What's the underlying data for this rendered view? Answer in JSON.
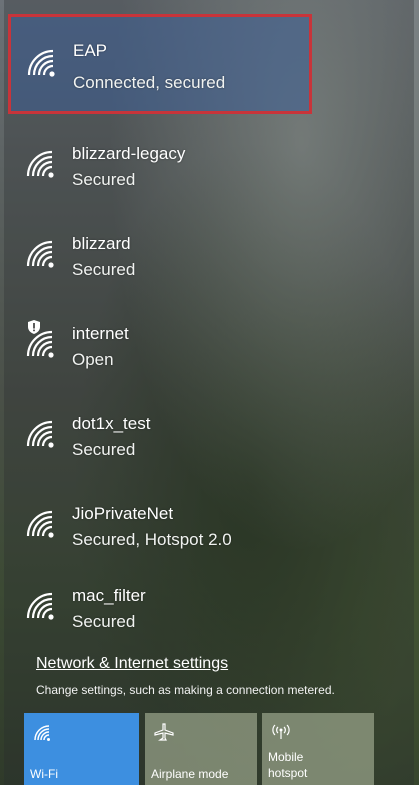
{
  "networks": [
    {
      "name": "EAP",
      "status": "Connected, secured",
      "icon": "wifi-signal-icon",
      "selected": true
    },
    {
      "name": "blizzard-legacy",
      "status": "Secured",
      "icon": "wifi-signal-icon"
    },
    {
      "name": "blizzard",
      "status": "Secured",
      "icon": "wifi-signal-icon"
    },
    {
      "name": "internet",
      "status": "Open",
      "icon": "wifi-signal-icon",
      "badge": "shield-warning-icon"
    },
    {
      "name": "dot1x_test",
      "status": "Secured",
      "icon": "wifi-signal-icon"
    },
    {
      "name": "JioPrivateNet",
      "status": "Secured, Hotspot 2.0",
      "icon": "wifi-signal-icon"
    },
    {
      "name": "mac_filter",
      "status": "Secured",
      "icon": "wifi-signal-icon"
    }
  ],
  "settings": {
    "link": "Network & Internet settings",
    "description": "Change settings, such as making a connection metered."
  },
  "quick_actions": {
    "wifi": {
      "label": "Wi-Fi",
      "icon": "wifi-icon",
      "active": true
    },
    "airplane": {
      "label": "Airplane mode",
      "icon": "airplane-icon"
    },
    "hotspot": {
      "label_line1": "Mobile",
      "label_line2": "hotspot",
      "icon": "hotspot-icon"
    }
  },
  "colors": {
    "selection_border": "#c8343a",
    "wifi_tile": "#3d8fe0"
  }
}
